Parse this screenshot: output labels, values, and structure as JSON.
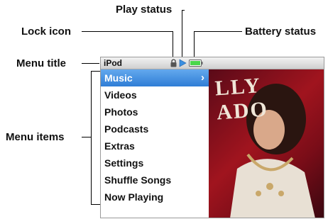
{
  "callouts": {
    "play_status": "Play status",
    "lock_icon": "Lock icon",
    "battery_status": "Battery status",
    "menu_title": "Menu title",
    "menu_items": "Menu items"
  },
  "screen": {
    "title": "iPod",
    "status_icons": [
      "lock-icon",
      "play-icon",
      "battery-icon"
    ],
    "battery_color": "#4bd64b",
    "accent": "#3a86dc",
    "menu": [
      {
        "label": "Music",
        "selected": true
      },
      {
        "label": "Videos"
      },
      {
        "label": "Photos"
      },
      {
        "label": "Podcasts"
      },
      {
        "label": "Extras"
      },
      {
        "label": "Settings"
      },
      {
        "label": "Shuffle Songs"
      },
      {
        "label": "Now Playing"
      }
    ],
    "album_art_text": "LLY\nADO"
  }
}
